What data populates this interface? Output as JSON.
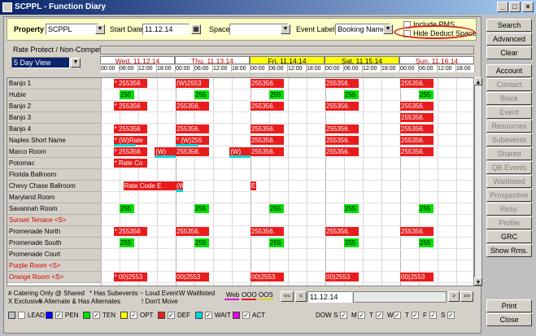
{
  "window": {
    "title": "SCPPL - Function Diary"
  },
  "filters": {
    "property_label": "Property",
    "property_value": "SCPPL",
    "start_date_label": "Start Date",
    "start_date_value": "11.12.14",
    "space_label": "Space",
    "space_value": "",
    "event_label_label": "Event Label",
    "event_label_value": "Booking Name",
    "include_pms_label": "Include PMS",
    "hide_deduct_label": "Hide Deduct Space"
  },
  "rate_protect_label": "Rate Protect / Non-Compete",
  "view_select": "5 Day View",
  "days": [
    {
      "label": "Wed, 11.12.14",
      "highlight": false
    },
    {
      "label": "Thu, 11.13.14",
      "highlight": false
    },
    {
      "label": "Fri, 11.14.14",
      "highlight": true
    },
    {
      "label": "Sat, 11.15.14",
      "highlight": true
    },
    {
      "label": "Sun, 11.16.14",
      "highlight": false
    }
  ],
  "times": [
    "00:00",
    "06:00",
    "12:00",
    "18:00"
  ],
  "rooms": [
    {
      "name": "Banjo 1",
      "red": false
    },
    {
      "name": "Hubie",
      "red": false
    },
    {
      "name": "Banjo 2",
      "red": false
    },
    {
      "name": "Banjo 3",
      "red": false
    },
    {
      "name": "Banjo 4",
      "red": false
    },
    {
      "name": "Naples Short Name",
      "red": false
    },
    {
      "name": "Marco Room",
      "red": false
    },
    {
      "name": "Potomac",
      "red": false
    },
    {
      "name": "Florida Ballroom",
      "red": false
    },
    {
      "name": "Chevy Chase Ballroom",
      "red": false
    },
    {
      "name": "Maryland Room",
      "red": false
    },
    {
      "name": "Savannah Room",
      "red": false
    },
    {
      "name": "Sunset Terrace <S>",
      "red": true
    },
    {
      "name": "Promenade North",
      "red": false
    },
    {
      "name": "Promenade South",
      "red": false
    },
    {
      "name": "Promenade Court",
      "red": false
    },
    {
      "name": "Purple Room <S>",
      "red": true
    },
    {
      "name": "Orange Room <S>",
      "red": true
    }
  ],
  "blocks": [
    {
      "row": 0,
      "day": 0,
      "start": 0.17,
      "width": 0.45,
      "color": "red",
      "text": "* 255356"
    },
    {
      "row": 0,
      "day": 1,
      "start": 0.0,
      "width": 0.45,
      "color": "red",
      "text": "(W)2553"
    },
    {
      "row": 0,
      "day": 2,
      "start": 0.0,
      "width": 0.45,
      "color": "red",
      "text": "255356."
    },
    {
      "row": 0,
      "day": 3,
      "start": 0.0,
      "width": 0.45,
      "color": "red",
      "text": "255356."
    },
    {
      "row": 0,
      "day": 4,
      "start": 0.0,
      "width": 0.45,
      "color": "red",
      "text": "255356."
    },
    {
      "row": 1,
      "day": 0,
      "start": 0.25,
      "width": 0.2,
      "color": "grn",
      "text": "255"
    },
    {
      "row": 1,
      "day": 1,
      "start": 0.25,
      "width": 0.2,
      "color": "grn",
      "text": "255"
    },
    {
      "row": 1,
      "day": 2,
      "start": 0.25,
      "width": 0.2,
      "color": "grn",
      "text": "255"
    },
    {
      "row": 1,
      "day": 3,
      "start": 0.25,
      "width": 0.2,
      "color": "grn",
      "text": "255"
    },
    {
      "row": 1,
      "day": 4,
      "start": 0.25,
      "width": 0.2,
      "color": "grn",
      "text": "255"
    },
    {
      "row": 2,
      "day": 0,
      "start": 0.17,
      "width": 0.45,
      "color": "red",
      "text": "* 255356"
    },
    {
      "row": 2,
      "day": 1,
      "start": 0.0,
      "width": 0.45,
      "color": "red",
      "text": "255356."
    },
    {
      "row": 2,
      "day": 2,
      "start": 0.0,
      "width": 0.45,
      "color": "red",
      "text": "255356."
    },
    {
      "row": 2,
      "day": 3,
      "start": 0.0,
      "width": 0.45,
      "color": "red",
      "text": "255356."
    },
    {
      "row": 2,
      "day": 4,
      "start": 0.0,
      "width": 0.45,
      "color": "red",
      "text": "255356."
    },
    {
      "row": 3,
      "day": 4,
      "start": 0.0,
      "width": 0.45,
      "color": "red",
      "text": "255356."
    },
    {
      "row": 4,
      "day": 0,
      "start": 0.17,
      "width": 0.45,
      "color": "red",
      "text": "* 255356"
    },
    {
      "row": 4,
      "day": 1,
      "start": 0.0,
      "width": 0.45,
      "color": "red",
      "text": "255356."
    },
    {
      "row": 4,
      "day": 2,
      "start": 0.0,
      "width": 0.45,
      "color": "red",
      "text": "255356."
    },
    {
      "row": 4,
      "day": 3,
      "start": 0.0,
      "width": 0.45,
      "color": "red",
      "text": "255356."
    },
    {
      "row": 4,
      "day": 4,
      "start": 0.0,
      "width": 0.45,
      "color": "red",
      "text": "255356."
    },
    {
      "row": 5,
      "day": 0,
      "start": 0.17,
      "width": 0.45,
      "color": "red",
      "text": "* (W)Rate"
    },
    {
      "row": 5,
      "day": 1,
      "start": 0.0,
      "width": 0.45,
      "color": "red",
      "text": "* (W)255"
    },
    {
      "row": 5,
      "day": 2,
      "start": 0.0,
      "width": 0.45,
      "color": "red",
      "text": "255356."
    },
    {
      "row": 5,
      "day": 3,
      "start": 0.0,
      "width": 0.45,
      "color": "red",
      "text": "255356."
    },
    {
      "row": 5,
      "day": 4,
      "start": 0.0,
      "width": 0.45,
      "color": "red",
      "text": "255356."
    },
    {
      "row": 6,
      "day": 0,
      "start": 0.17,
      "width": 0.45,
      "color": "red",
      "text": "* 255356"
    },
    {
      "row": 6,
      "day": 0,
      "start": 0.72,
      "width": 0.28,
      "color": "red",
      "text": "(W)"
    },
    {
      "row": 6,
      "day": 1,
      "start": 0.0,
      "width": 0.45,
      "color": "red",
      "text": "255356."
    },
    {
      "row": 6,
      "day": 1,
      "start": 0.72,
      "width": 0.28,
      "color": "red",
      "text": "(W)"
    },
    {
      "row": 6,
      "day": 2,
      "start": 0.0,
      "width": 0.45,
      "color": "red",
      "text": "255356."
    },
    {
      "row": 6,
      "day": 3,
      "start": 0.0,
      "width": 0.45,
      "color": "red",
      "text": "255356."
    },
    {
      "row": 6,
      "day": 4,
      "start": 0.0,
      "width": 0.45,
      "color": "red",
      "text": "255356."
    },
    {
      "row": 7,
      "day": 0,
      "start": 0.17,
      "width": 0.45,
      "color": "red",
      "text": "* Rate Co"
    },
    {
      "row": 9,
      "day": 0,
      "start": 0.3,
      "width": 0.7,
      "color": "red",
      "text": "Rate Code E"
    },
    {
      "row": 9,
      "day": 1,
      "start": 0.0,
      "width": 0.1,
      "color": "red",
      "text": "(W)"
    },
    {
      "row": 9,
      "day": 2,
      "start": 0.0,
      "width": 0.08,
      "color": "red",
      "text": "E"
    },
    {
      "row": 11,
      "day": 0,
      "start": 0.25,
      "width": 0.2,
      "color": "grn",
      "text": "255"
    },
    {
      "row": 11,
      "day": 1,
      "start": 0.25,
      "width": 0.2,
      "color": "grn",
      "text": "255"
    },
    {
      "row": 11,
      "day": 2,
      "start": 0.25,
      "width": 0.2,
      "color": "grn",
      "text": "255"
    },
    {
      "row": 11,
      "day": 3,
      "start": 0.25,
      "width": 0.2,
      "color": "grn",
      "text": "255"
    },
    {
      "row": 11,
      "day": 4,
      "start": 0.25,
      "width": 0.2,
      "color": "grn",
      "text": "255"
    },
    {
      "row": 13,
      "day": 0,
      "start": 0.17,
      "width": 0.45,
      "color": "red",
      "text": "* 255356"
    },
    {
      "row": 13,
      "day": 1,
      "start": 0.0,
      "width": 0.45,
      "color": "red",
      "text": "255356."
    },
    {
      "row": 13,
      "day": 2,
      "start": 0.0,
      "width": 0.45,
      "color": "red",
      "text": "255356."
    },
    {
      "row": 13,
      "day": 3,
      "start": 0.0,
      "width": 0.45,
      "color": "red",
      "text": "255356."
    },
    {
      "row": 13,
      "day": 4,
      "start": 0.0,
      "width": 0.45,
      "color": "red",
      "text": "255356."
    },
    {
      "row": 14,
      "day": 0,
      "start": 0.25,
      "width": 0.2,
      "color": "grn",
      "text": "255"
    },
    {
      "row": 14,
      "day": 1,
      "start": 0.25,
      "width": 0.2,
      "color": "grn",
      "text": "255"
    },
    {
      "row": 14,
      "day": 2,
      "start": 0.25,
      "width": 0.2,
      "color": "grn",
      "text": "255"
    },
    {
      "row": 14,
      "day": 3,
      "start": 0.25,
      "width": 0.2,
      "color": "grn",
      "text": "255"
    },
    {
      "row": 14,
      "day": 4,
      "start": 0.25,
      "width": 0.2,
      "color": "grn",
      "text": "255"
    },
    {
      "row": 17,
      "day": 0,
      "start": 0.17,
      "width": 0.45,
      "color": "red",
      "text": "* 00)2553"
    },
    {
      "row": 17,
      "day": 1,
      "start": 0.0,
      "width": 0.45,
      "color": "red",
      "text": "00)2553"
    },
    {
      "row": 17,
      "day": 2,
      "start": 0.0,
      "width": 0.45,
      "color": "red",
      "text": "00)2553"
    },
    {
      "row": 17,
      "day": 3,
      "start": 0.0,
      "width": 0.45,
      "color": "red",
      "text": "00)2553"
    },
    {
      "row": 17,
      "day": 4,
      "start": 0.0,
      "width": 0.45,
      "color": "red",
      "text": "00)2553"
    }
  ],
  "waitlist_bars": [
    {
      "row": 5,
      "day": 0,
      "start": 0.17,
      "width": 0.3
    },
    {
      "row": 5,
      "day": 1,
      "start": 0.0,
      "width": 0.3
    },
    {
      "row": 6,
      "day": 0,
      "start": 0.72,
      "width": 0.28
    },
    {
      "row": 6,
      "day": 1,
      "start": 0.72,
      "width": 0.28
    },
    {
      "row": 9,
      "day": 1,
      "start": 0.0,
      "width": 0.1
    }
  ],
  "right_buttons": [
    {
      "label": "Search",
      "enabled": true,
      "underline": true
    },
    {
      "label": "Advanced",
      "enabled": true
    },
    {
      "label": "Clear",
      "enabled": true
    },
    {
      "label": "Account",
      "enabled": true
    },
    {
      "label": "Contact",
      "enabled": false
    },
    {
      "label": "Block",
      "enabled": false
    },
    {
      "label": "Event",
      "enabled": false
    },
    {
      "label": "Resources",
      "enabled": false
    },
    {
      "label": "Subevents",
      "enabled": false
    },
    {
      "label": "Shared",
      "enabled": false
    },
    {
      "label": "QB Events",
      "enabled": false
    },
    {
      "label": "Waitlisted",
      "enabled": false
    },
    {
      "label": "Prospective",
      "enabled": false
    },
    {
      "label": "Resy.",
      "enabled": false
    },
    {
      "label": "Profile",
      "enabled": false
    },
    {
      "label": "GRC",
      "enabled": true
    },
    {
      "label": "Show Rms.",
      "enabled": true
    }
  ],
  "bottom_buttons": [
    {
      "label": "Print"
    },
    {
      "label": "Close"
    }
  ],
  "legend_notes": [
    "# Catering Only @ Shared",
    "* Has Subevents ~ Loud Event",
    "W Waitlisted",
    "X Exclusive",
    "\\\\ Alternate & Has Alternates",
    "! Don't Move"
  ],
  "legend_lines": {
    "web": "Web",
    "ooo": "OOO",
    "oos": "OOS"
  },
  "nav": {
    "date": "11.12.14",
    "first": "<<",
    "prev": "<",
    "next": ">",
    "last": ">>"
  },
  "status_legend": [
    {
      "label": "LEAD",
      "color": "#c0c0c0",
      "checked": false
    },
    {
      "label": "PEN",
      "color": "#0000ff",
      "checked": true
    },
    {
      "label": "TEN",
      "color": "#00e000",
      "checked": true
    },
    {
      "label": "OPT",
      "color": "#ffff00",
      "checked": true
    },
    {
      "label": "DEF",
      "color": "#e81c1c",
      "checked": true
    },
    {
      "label": "WAIT",
      "color": "#00d8d8",
      "checked": true
    },
    {
      "label": "ACT",
      "color": "#e000e0",
      "checked": true
    }
  ],
  "dow": {
    "label": "DOW",
    "days": [
      "S",
      "M",
      "T",
      "W",
      "T",
      "F",
      "S"
    ]
  }
}
